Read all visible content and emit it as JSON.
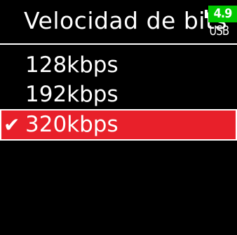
{
  "header": {
    "title": "Velocidad de bits",
    "battery": {
      "voltage": "4.9",
      "source": "USB",
      "color": "#00c800"
    }
  },
  "menu": {
    "items": [
      {
        "label": "128kbps",
        "selected": false,
        "check": ""
      },
      {
        "label": "192kbps",
        "selected": false,
        "check": ""
      },
      {
        "label": "320kbps",
        "selected": true,
        "check": "✔"
      }
    ],
    "selected_color": "#e8202a"
  }
}
